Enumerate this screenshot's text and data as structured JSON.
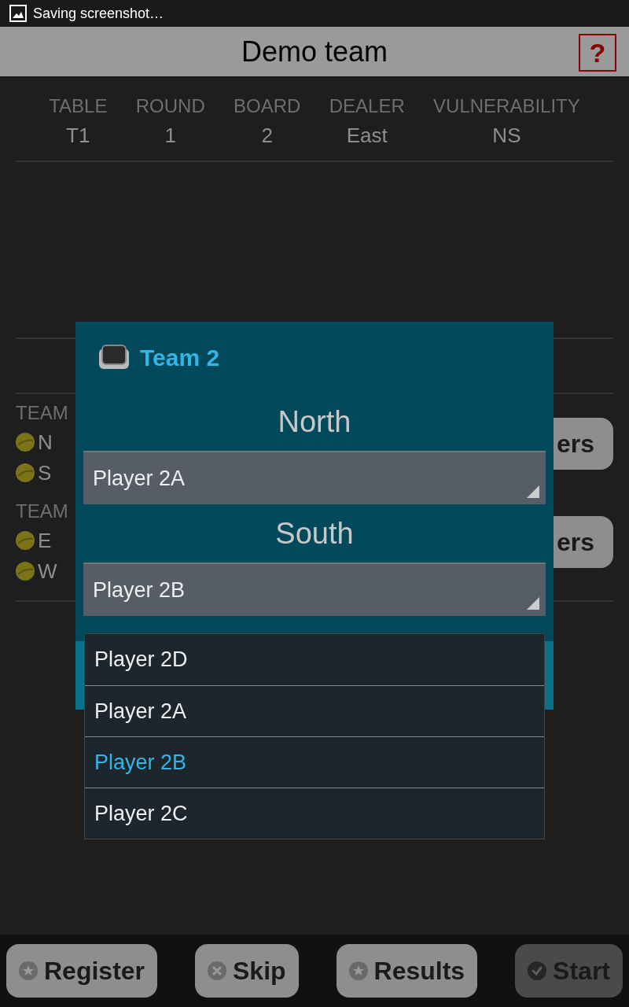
{
  "status_bar": {
    "notification": "Saving screenshot…"
  },
  "header": {
    "title": "Demo team",
    "help_label": "?"
  },
  "info": [
    {
      "label": "TABLE",
      "value": "T1"
    },
    {
      "label": "ROUND",
      "value": "1"
    },
    {
      "label": "BOARD",
      "value": "2"
    },
    {
      "label": "DEALER",
      "value": "East"
    },
    {
      "label": "VULNERABILITY",
      "value": "NS"
    }
  ],
  "teams": [
    {
      "label": "TEAM",
      "players": [
        "N",
        "S"
      ],
      "button": "ers"
    },
    {
      "label": "TEAM",
      "players": [
        "E",
        "W"
      ],
      "button": "ers"
    }
  ],
  "dialog": {
    "title": "Team 2",
    "sections": [
      {
        "heading": "North",
        "value": "Player 2A"
      },
      {
        "heading": "South",
        "value": "Player 2B"
      }
    ]
  },
  "dropdown": [
    {
      "label": "Player 2D",
      "selected": false
    },
    {
      "label": "Player 2A",
      "selected": false
    },
    {
      "label": "Player 2B",
      "selected": true
    },
    {
      "label": "Player 2C",
      "selected": false
    }
  ],
  "toolbar": [
    {
      "label": "Register",
      "kind": "star",
      "disabled": false
    },
    {
      "label": "Skip",
      "kind": "cross",
      "disabled": false
    },
    {
      "label": "Results",
      "kind": "star",
      "disabled": false
    },
    {
      "label": "Start",
      "kind": "check",
      "disabled": true
    }
  ]
}
